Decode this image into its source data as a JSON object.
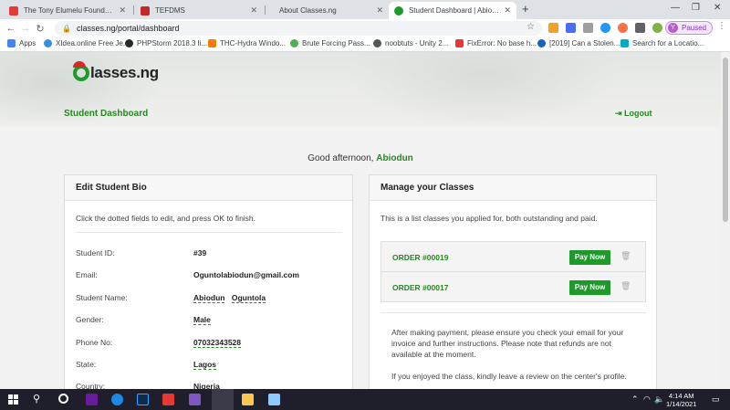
{
  "browser": {
    "tabs": [
      {
        "title": "The Tony Elumelu Foundation - E",
        "color": "#e53935",
        "active": false
      },
      {
        "title": "TEFDMS",
        "color": "#c62828",
        "active": false
      },
      {
        "title": "About Classes.ng",
        "color": "#ffffff",
        "active": false
      },
      {
        "title": "Student Dashboard | Abiodun Og",
        "color": "#1e9a2b",
        "active": true
      }
    ],
    "url": "classes.ng/portal/dashboard",
    "profile_letter": "Y",
    "profile_status": "Paused",
    "bookmarks": [
      {
        "label": "Apps",
        "color": "#4285f4"
      },
      {
        "label": "XIdea.online Free Je...",
        "color": "#3b8ede"
      },
      {
        "label": "PHPStorm 2018.3 li...",
        "color": "#24292e"
      },
      {
        "label": "THC-Hydra Windo...",
        "color": "#f57c00"
      },
      {
        "label": "Brute Forcing Pass...",
        "color": "#4caf50"
      },
      {
        "label": "noobtuts - Unity 2...",
        "color": "#555555"
      },
      {
        "label": "FixError: No base h...",
        "color": "#e53935"
      },
      {
        "label": "[2019] Can a Stolen...",
        "color": "#1565c0"
      },
      {
        "label": "Search for a Locatio...",
        "color": "#00acc1"
      }
    ]
  },
  "header": {
    "logo_text": "lasses.ng",
    "dashboard_title": "Student Dashboard",
    "logout_label": "Logout"
  },
  "greeting": {
    "prefix": "Good afternoon,",
    "name": "Abiodun"
  },
  "bio": {
    "title": "Edit Student Bio",
    "intro": "Click the dotted fields to edit, and press OK to finish.",
    "fields": [
      {
        "label": "Student ID:",
        "value": "#39"
      },
      {
        "label": "Email:",
        "value": "Oguntolabiodun@gmail.com"
      },
      {
        "label": "Student Name:",
        "value": "Abiodun",
        "value2": "Oguntola"
      },
      {
        "label": "Gender:",
        "value": "Male"
      },
      {
        "label": "Phone No:",
        "value": "07032343528"
      },
      {
        "label": "State:",
        "value": "Lagos"
      },
      {
        "label": "Country:",
        "value": "Nigeria"
      }
    ]
  },
  "classes": {
    "title": "Manage your Classes",
    "intro": "This is a list classes you applied for, both outstanding and paid.",
    "orders": [
      {
        "id": "ORDER #00019",
        "action": "Pay Now"
      },
      {
        "id": "ORDER #00017",
        "action": "Pay Now"
      }
    ],
    "note1": "After making payment, please ensure you check your email for your invoice and further instructions. Please note that refunds are not available at the moment.",
    "note2": "If you enjoyed the class, kindly leave a review on the center's profile."
  },
  "taskbar": {
    "time": "4:14 AM",
    "date": "1/14/2021"
  },
  "colors": {
    "brand_green": "#23891e",
    "button_green": "#1e9a2b"
  }
}
